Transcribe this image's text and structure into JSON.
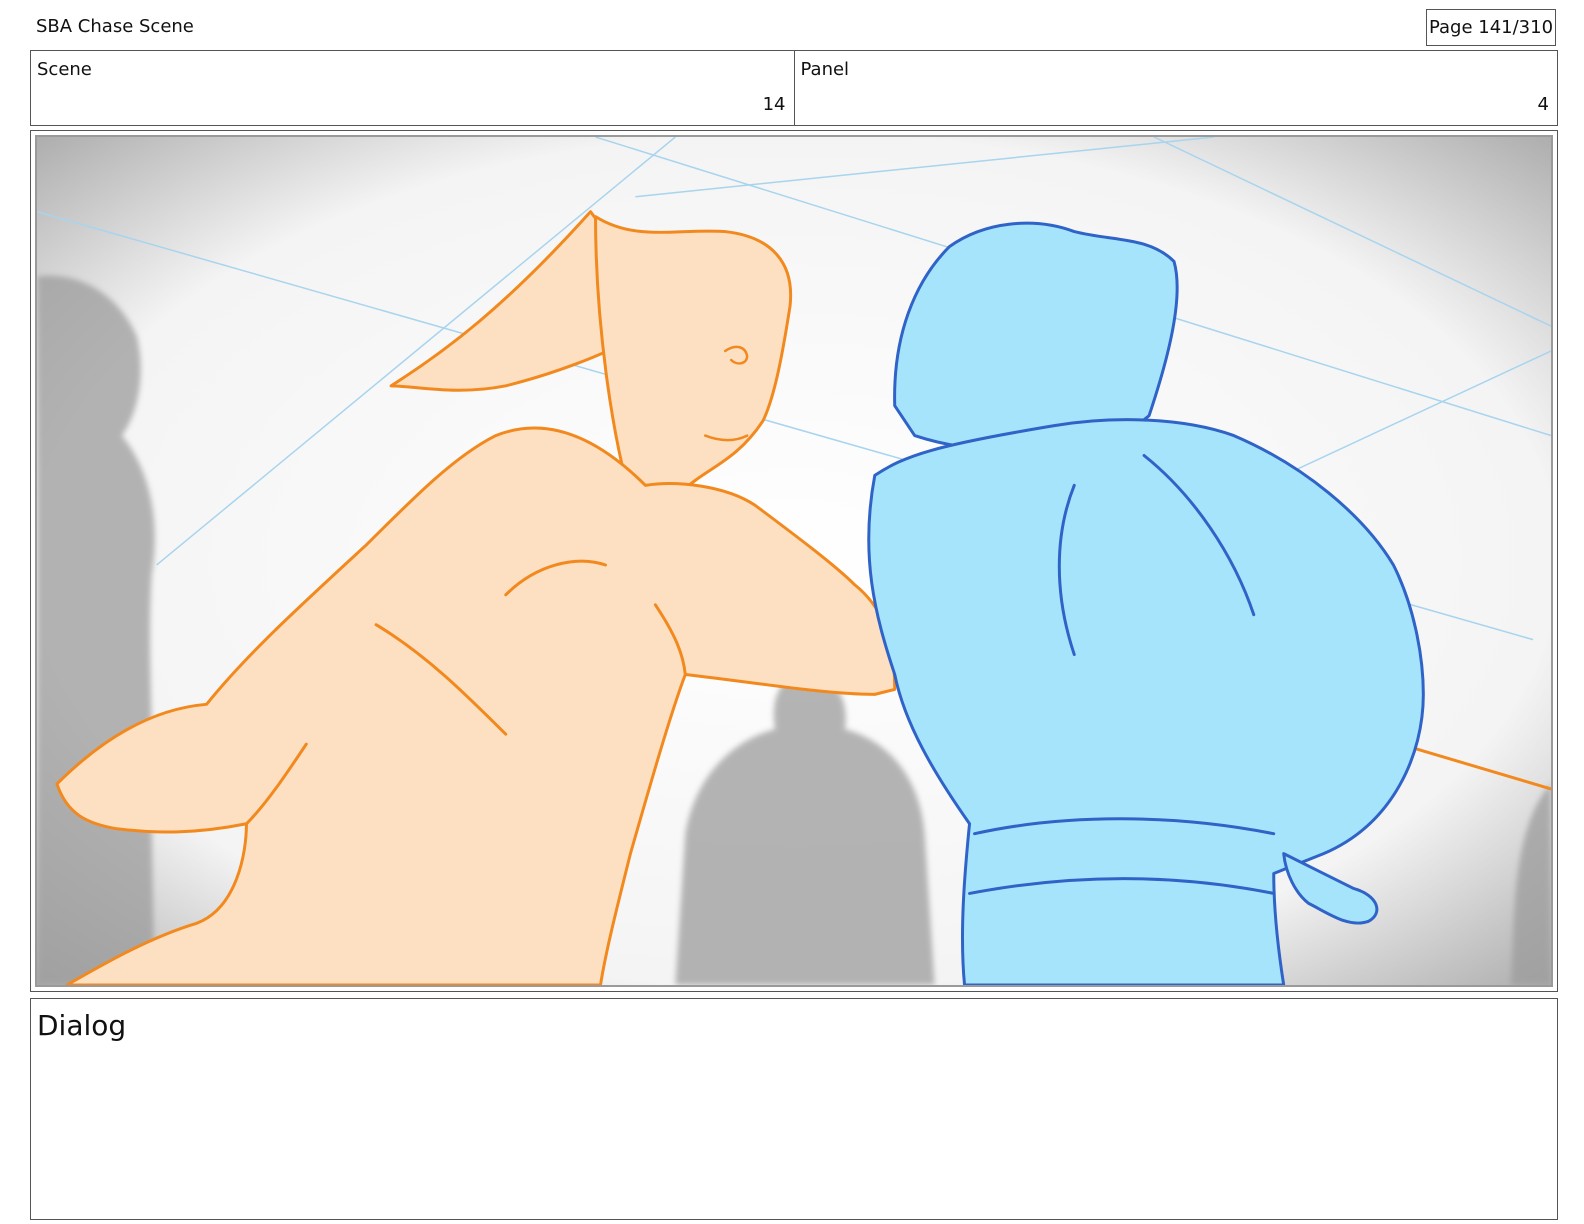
{
  "document": {
    "title": "SBA Chase Scene",
    "page_label": "Page 141/310"
  },
  "header": {
    "scene": {
      "label": "Scene",
      "value": "14"
    },
    "panel": {
      "label": "Panel",
      "value": "4"
    }
  },
  "dialog": {
    "label": "Dialog"
  },
  "colors": {
    "orange_fill": "#fde0c2",
    "orange_line": "#f2891e",
    "blue_fill": "#a6e4fb",
    "blue_line": "#2f63c8",
    "guide_line": "#a8d4ee",
    "bg_figure": "#9c9c9c"
  }
}
